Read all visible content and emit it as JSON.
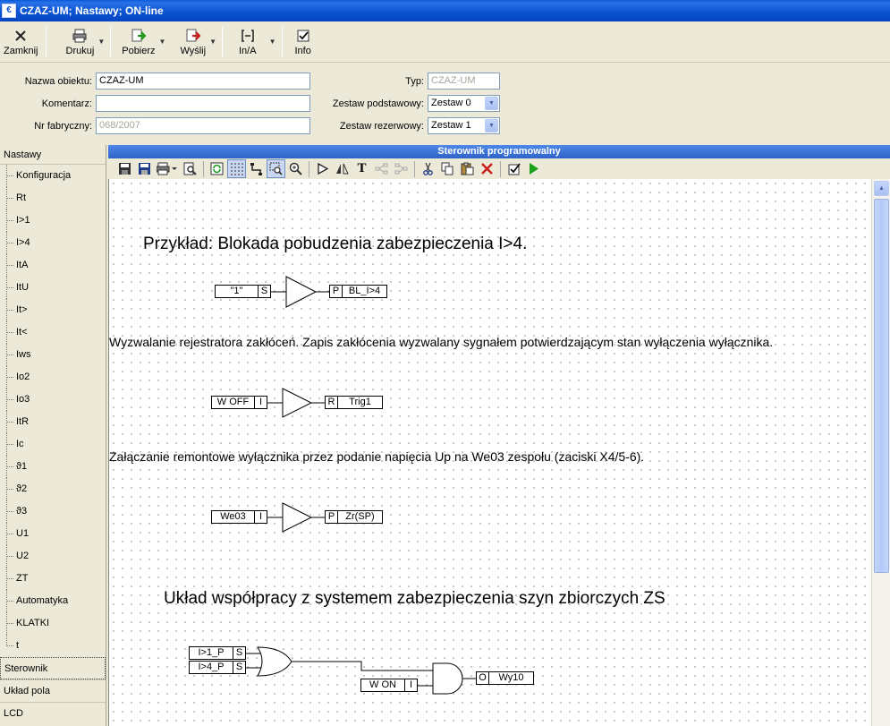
{
  "window": {
    "title": "CZAZ-UM; Nastawy; ON-line"
  },
  "toolbar": {
    "close": "Zamknij",
    "print": "Drukuj",
    "fetch": "Pobierz",
    "send": "Wyślij",
    "ina": "In/A",
    "info": "Info"
  },
  "form": {
    "object_name_label": "Nazwa obiektu:",
    "object_name": "CZAZ-UM",
    "comment_label": "Komentarz:",
    "comment": "",
    "serial_label": "Nr fabryczny:",
    "serial": "068/2007",
    "type_label": "Typ:",
    "type": "CZAZ-UM",
    "base_set_label": "Zestaw podstawowy:",
    "base_set": "Zestaw 0",
    "backup_set_label": "Zestaw rezerwowy:",
    "backup_set": "Zestaw 1"
  },
  "nav": {
    "header": "Nastawy",
    "items": [
      "Konfiguracja",
      "Rt",
      "I>1",
      "I>4",
      "ItA",
      "ItU",
      "It>",
      "It<",
      "Iws",
      "Io2",
      "Io3",
      "ItR",
      "Ic",
      "ϑ1",
      "ϑ2",
      "ϑ3",
      "U1",
      "U2",
      "ZT",
      "Automatyka",
      "KLATKI",
      "t"
    ],
    "groups": [
      "Sterownik",
      "Układ pola",
      "LCD"
    ]
  },
  "panel": {
    "title": "Sterownik programowalny"
  },
  "diagram": {
    "heading1": "Przykład: Blokada pobudzenia zabezpieczenia I>4.",
    "desc1": "Wyzwalanie rejestratora zakłóceń. Zapis zakłócenia wyzwalany sygnałem potwierdzającym stan wyłączenia wyłącznika.",
    "desc2": "Załączanie remontowe wyłącznika przez podanie napięcia Up na We03 zespołu (zaciski X4/5-6).",
    "heading2": "Układ współpracy z systemem zabezpieczenia szyn zbiorczych ZS",
    "b1_in": "\"1\"",
    "b1_in_pin": "S",
    "b1_out_pin": "P",
    "b1_out": "BL_I>4",
    "b2_in": "W OFF",
    "b2_in_pin": "I",
    "b2_out_pin": "R",
    "b2_out": "Trig1",
    "b3_in": "We03",
    "b3_in_pin": "I",
    "b3_out_pin": "P",
    "b3_out": "Zr(SP)",
    "b4_in1": "I>1_P",
    "b4_in1_pin": "S",
    "b4_in2": "I>4_P",
    "b4_in2_pin": "S",
    "b4_in3": "W ON",
    "b4_in3_pin": "I",
    "b4_out_pin": "O",
    "b4_out": "Wy10"
  }
}
